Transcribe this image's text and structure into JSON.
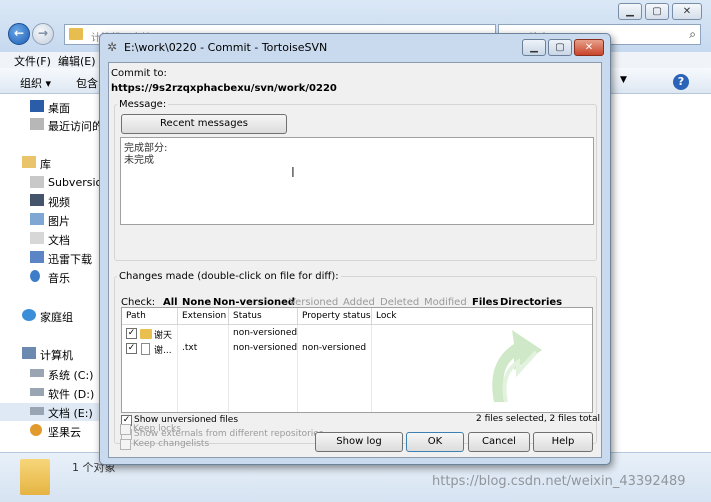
{
  "explorer": {
    "address_text": "计算机 › 文档 (E:) › ... › 0220",
    "search_placeholder": "搜索 0220",
    "menu": [
      "文件(F)",
      "编辑(E)"
    ],
    "toolbar": [
      "组织 ▾",
      "包含"
    ],
    "nav": {
      "desktop": "桌面",
      "recent": "最近访问的",
      "libraries": "库",
      "subversion": "Subversio",
      "videos": "视频",
      "pictures": "图片",
      "documents": "文档",
      "thunder": "迅雷下载",
      "music": "音乐",
      "homegroup": "家庭组",
      "computer": "计算机",
      "drive_c": "系统 (C:)",
      "drive_d": "软件 (D:)",
      "drive_e": "文档 (E:)",
      "jianguoyun": "坚果云"
    },
    "status_count": "1 个对象",
    "watermark": "https://blog.csdn.net/weixin_43392489"
  },
  "dialog": {
    "title": "E:\\work\\0220 - Commit - TortoiseSVN",
    "commit_to_label": "Commit to:",
    "commit_url": "https://9s2rzqxphacbexu/svn/work/0220",
    "message_label": "Message:",
    "recent_messages_label": "Recent messages",
    "message_lines": [
      "完成部分:",
      "未完成"
    ],
    "changes_label": "Changes made (double-click on file for diff):",
    "check_label": "Check:",
    "check_filters": {
      "all": "All",
      "none": "None",
      "non_versioned": "Non-versioned",
      "versioned": "Versioned",
      "added": "Added",
      "deleted": "Deleted",
      "modified": "Modified",
      "files": "Files",
      "directories": "Directories"
    },
    "columns": [
      "Path",
      "Extension",
      "Status",
      "Property status",
      "Lock"
    ],
    "files": [
      {
        "checked": "✓",
        "icon": "folder-icon",
        "path": "谢天",
        "extension": "",
        "status": "non-versioned",
        "property_status": "",
        "lock": ""
      },
      {
        "checked": "✓",
        "icon": "file-icon",
        "path": "谢...",
        "extension": ".txt",
        "status": "non-versioned",
        "property_status": "non-versioned",
        "lock": ""
      }
    ],
    "show_unversioned_label": "Show unversioned files",
    "show_unversioned_checked": "✓",
    "show_externals_label": "Show externals from different repositories",
    "show_externals_checked": "✓",
    "selection_summary": "2 files selected, 2 files total",
    "keep_locks_label": "Keep locks",
    "keep_changelists_label": "Keep changelists",
    "buttons": {
      "show_log": "Show log",
      "ok": "OK",
      "cancel": "Cancel",
      "help": "Help"
    },
    "accent_color": "#c9daef"
  }
}
